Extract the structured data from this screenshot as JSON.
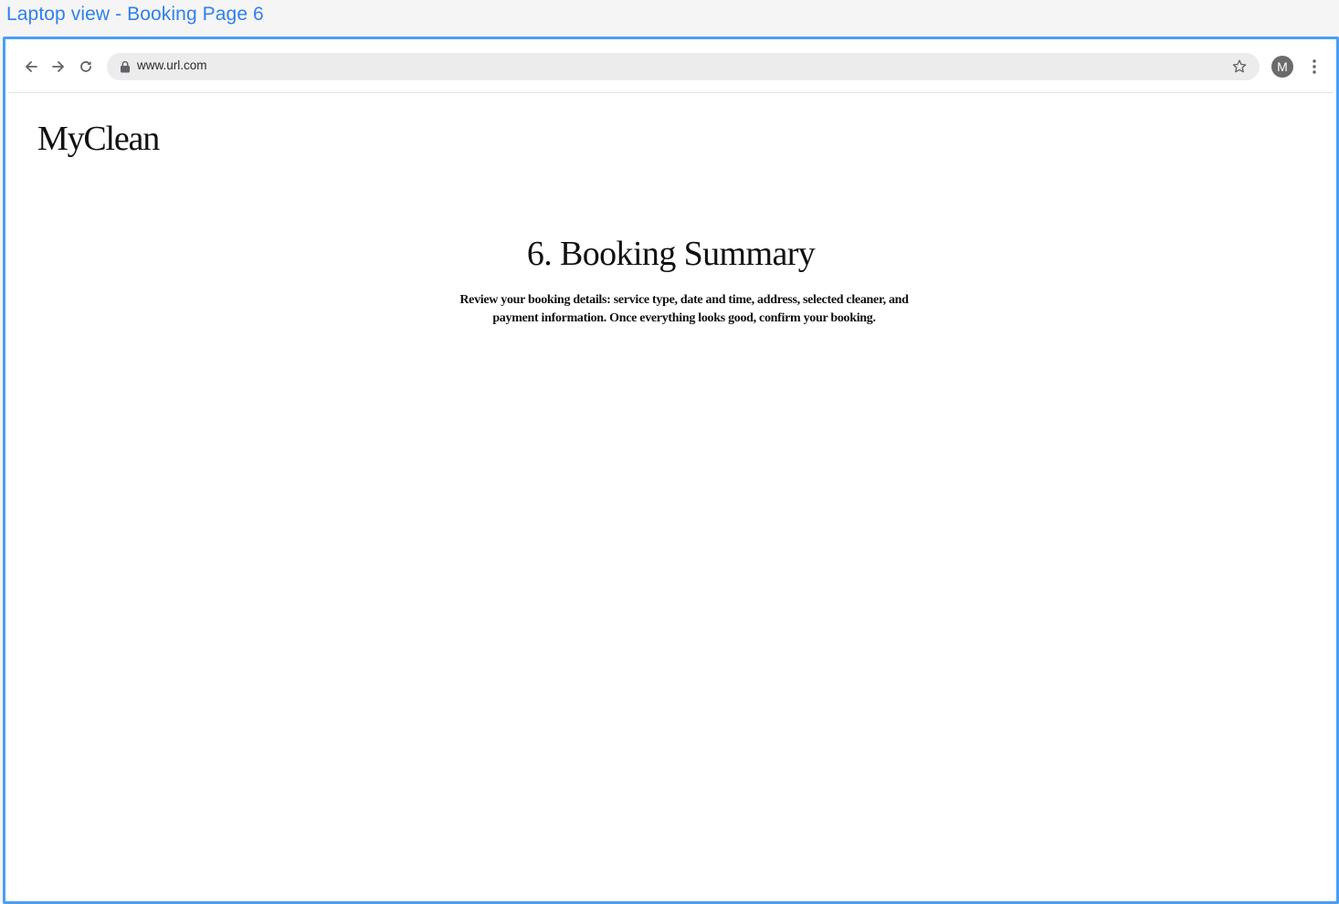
{
  "frame": {
    "label": "Laptop view - Booking Page 6",
    "label_color": "#2f80ed",
    "border_color": "#4a9ff5"
  },
  "browser": {
    "url": "www.url.com",
    "avatar_initial": "M",
    "icons": {
      "back": "arrow-left-icon",
      "forward": "arrow-right-icon",
      "reload": "reload-icon",
      "lock": "lock-icon",
      "bookmark": "star-icon",
      "menu": "kebab-menu-icon"
    }
  },
  "page": {
    "logo": "MyClean",
    "title": "6. Booking Summary",
    "description": "Review your booking details: service type, date and time, address, selected cleaner, and payment information. Once everything looks good, confirm your booking."
  }
}
